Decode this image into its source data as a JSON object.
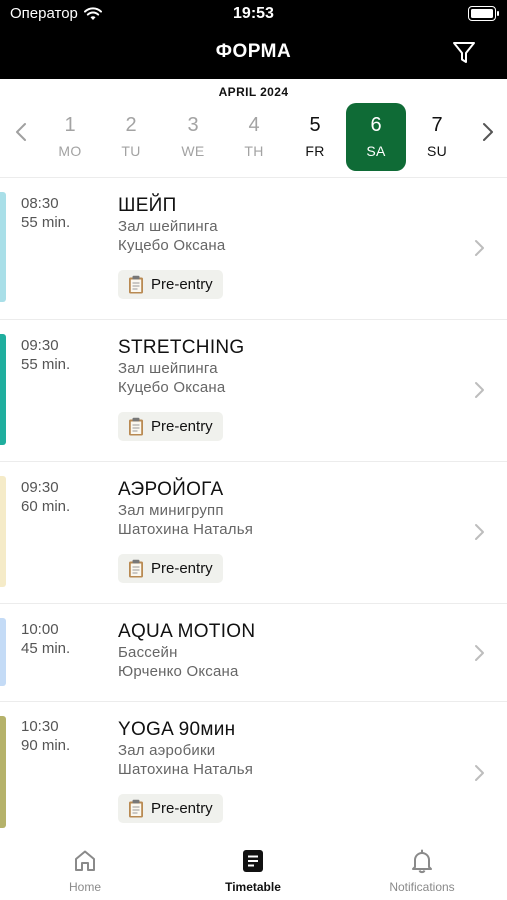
{
  "status_bar": {
    "carrier": "Оператор",
    "time": "19:53"
  },
  "header": {
    "title": "ФОРМА"
  },
  "calendar": {
    "month": "APRIL 2024",
    "days": [
      {
        "num": "1",
        "dow": "MO",
        "state": "past"
      },
      {
        "num": "2",
        "dow": "TU",
        "state": "past"
      },
      {
        "num": "3",
        "dow": "WE",
        "state": "past"
      },
      {
        "num": "4",
        "dow": "TH",
        "state": "past"
      },
      {
        "num": "5",
        "dow": "FR",
        "state": "future"
      },
      {
        "num": "6",
        "dow": "SA",
        "state": "selected"
      },
      {
        "num": "7",
        "dow": "SU",
        "state": "future"
      }
    ]
  },
  "colors": {
    "selected_day": "#0f6b36",
    "accent_black": "#000000"
  },
  "classes": [
    {
      "time": "08:30",
      "duration": "55 min.",
      "title": "ШЕЙП",
      "room": "Зал шейпинга",
      "trainer": "Куцебо Оксана",
      "badge": "Pre-entry",
      "color": "#a9dfe8"
    },
    {
      "time": "09:30",
      "duration": "55 min.",
      "title": "STRETCHING",
      "room": "Зал шейпинга",
      "trainer": "Куцебо Оксана",
      "badge": "Pre-entry",
      "color": "#1fae9e"
    },
    {
      "time": "09:30",
      "duration": "60 min.",
      "title": "АЭРОЙОГА",
      "room": "Зал минигрупп",
      "trainer": "Шатохина  Наталья",
      "badge": "Pre-entry",
      "color": "#f5ebc8"
    },
    {
      "time": "10:00",
      "duration": "45 min.",
      "title": "AQUA  MOTION",
      "room": "Бассейн",
      "trainer": "Юрченко Оксана",
      "badge": "",
      "color": "#c4dbf6"
    },
    {
      "time": "10:30",
      "duration": "90 min.",
      "title": "YOGA 90мин",
      "room": "Зал аэробики",
      "trainer": "Шатохина  Наталья",
      "badge": "Pre-entry",
      "color": "#b5b26a"
    }
  ],
  "tabbar": {
    "tabs": [
      {
        "label": "Home",
        "icon": "home-icon",
        "active": false
      },
      {
        "label": "Timetable",
        "icon": "timetable-icon",
        "active": true
      },
      {
        "label": "Notifications",
        "icon": "bell-icon",
        "active": false
      }
    ]
  }
}
